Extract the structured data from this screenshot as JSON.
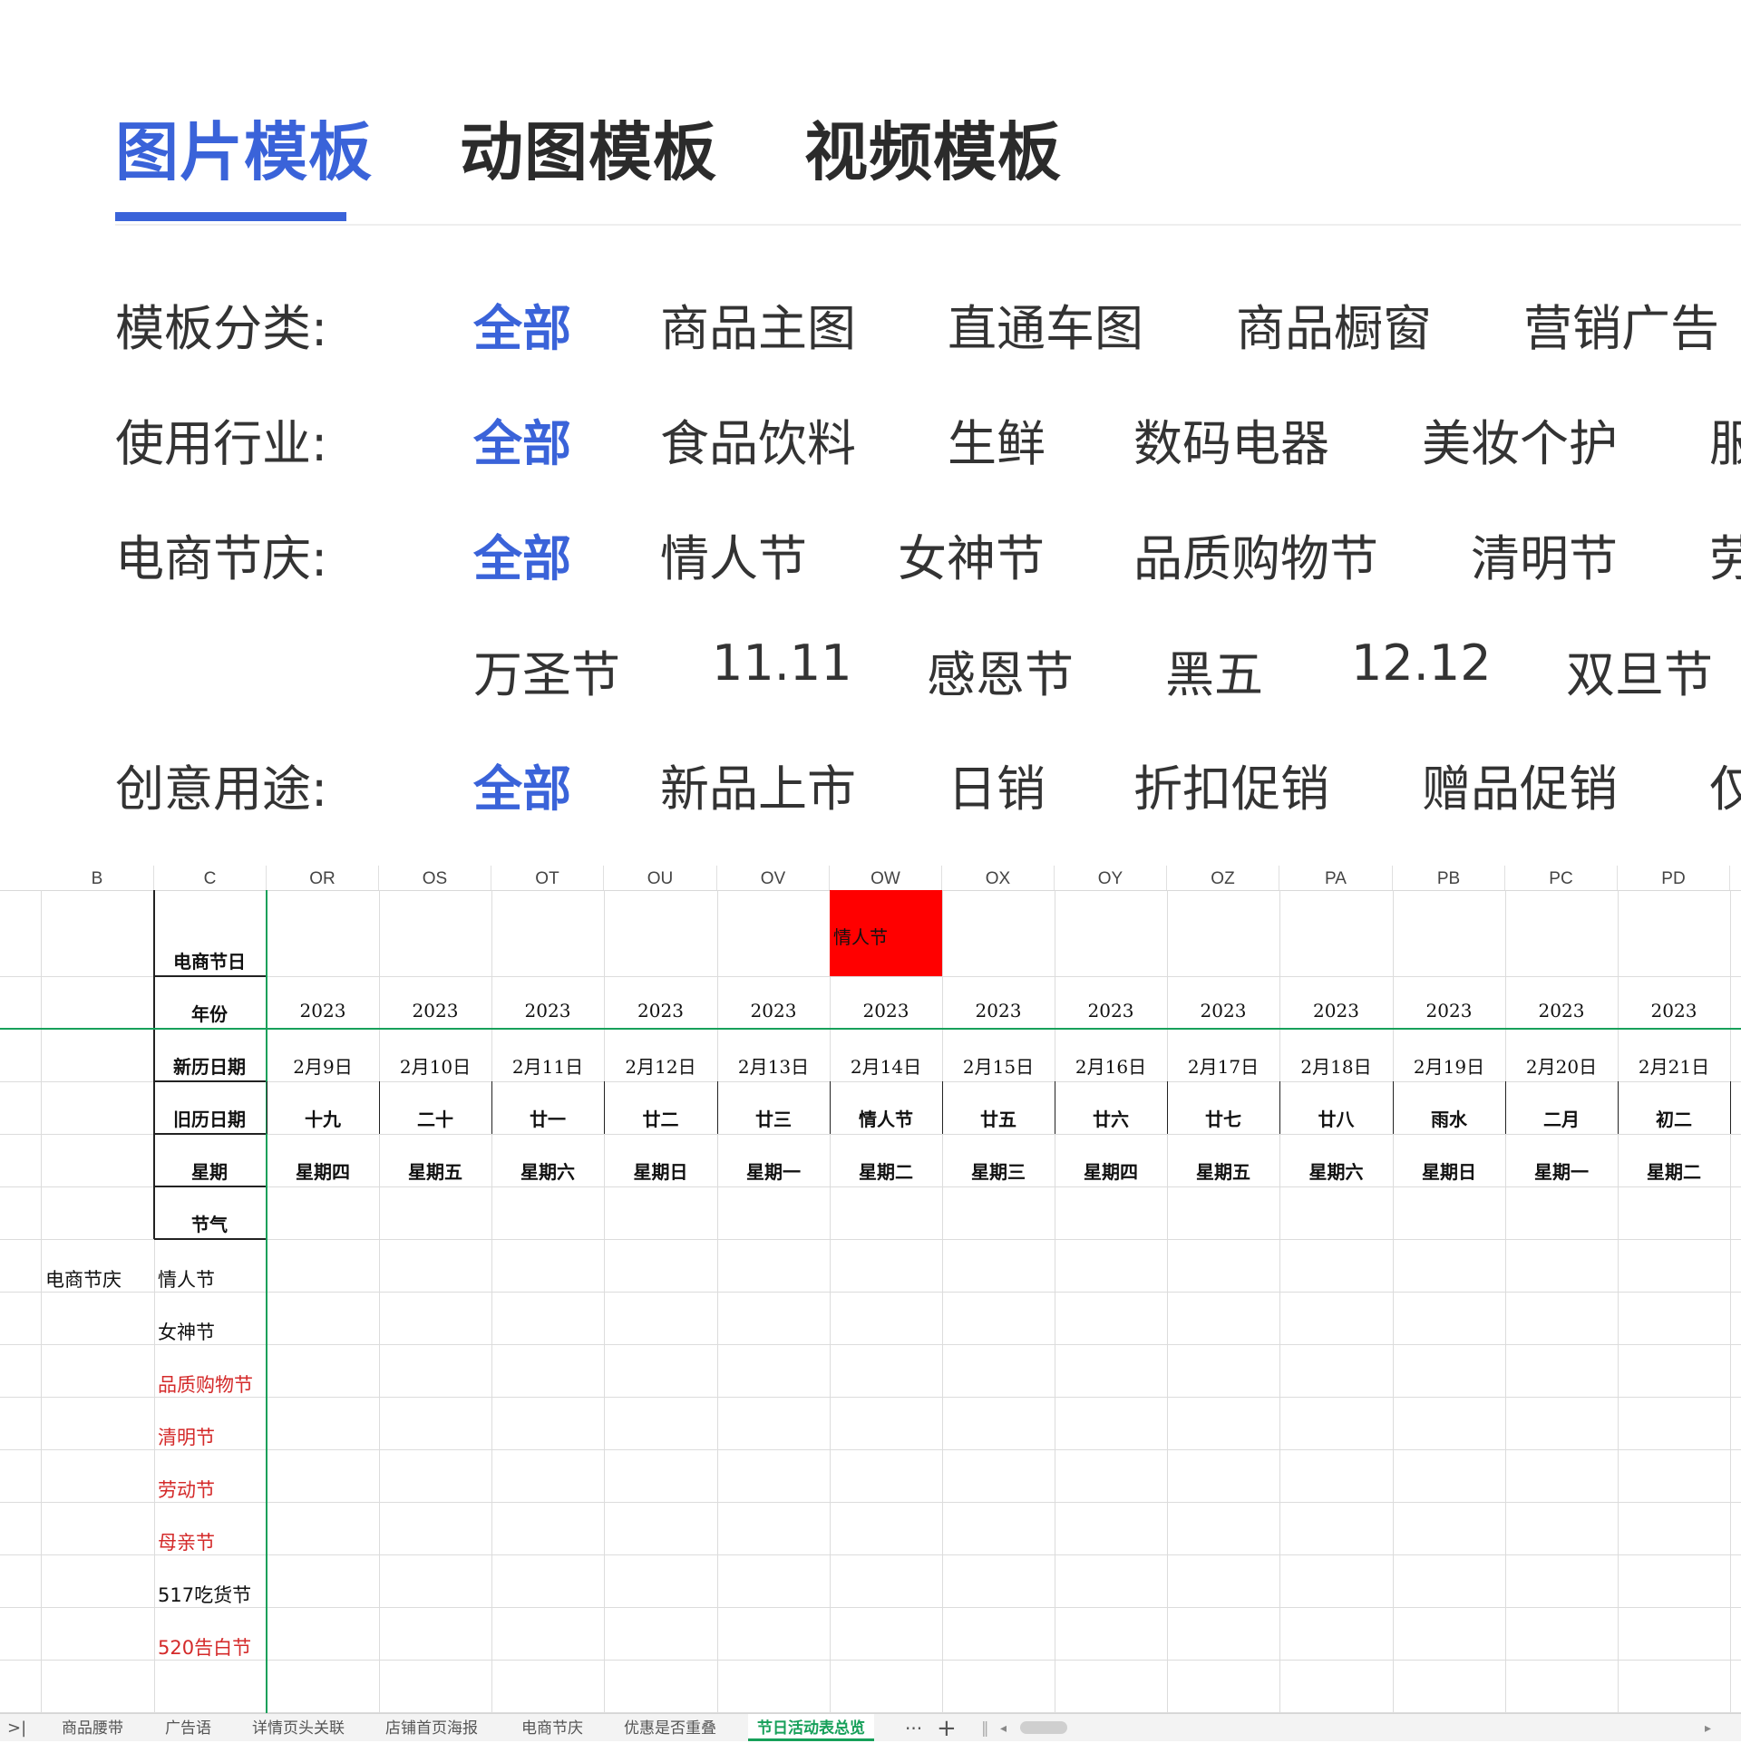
{
  "tabs": [
    "图片模板",
    "动图模板",
    "视频模板"
  ],
  "filters": {
    "category": {
      "label": "模板分类:",
      "options": [
        "全部",
        "商品主图",
        "直通车图",
        "商品橱窗",
        "营销广告"
      ]
    },
    "industry": {
      "label": "使用行业:",
      "options": [
        "全部",
        "食品饮料",
        "生鲜",
        "数码电器",
        "美妆个护",
        "服"
      ]
    },
    "festival": {
      "label": "电商节庆:",
      "options": [
        "全部",
        "情人节",
        "女神节",
        "品质购物节",
        "清明节",
        "劳"
      ]
    },
    "festival2": {
      "options": [
        "万圣节",
        "11.11",
        "感恩节",
        "黑五",
        "12.12",
        "双旦节"
      ]
    },
    "usage": {
      "label": "创意用途:",
      "options": [
        "全部",
        "新品上市",
        "日销",
        "折扣促销",
        "赠品促销",
        "仅"
      ]
    }
  },
  "colors": {
    "accent": "#3a63d9",
    "highlight": "#ff0000",
    "red_text": "#d42a2a",
    "sheet_green": "#17a05a"
  },
  "sheet": {
    "column_headers": [
      "B",
      "C",
      "OR",
      "OS",
      "OT",
      "OU",
      "OV",
      "OW",
      "OX",
      "OY",
      "OZ",
      "PA",
      "PB",
      "PC",
      "PD"
    ],
    "row_labels": {
      "festival_day": "电商节日",
      "year": "年份",
      "new_date": "新历日期",
      "old_date": "旧历日期",
      "weekday": "星期",
      "solar_term": "节气"
    },
    "highlight_cell": "情人节",
    "years": [
      "2023",
      "2023",
      "2023",
      "2023",
      "2023",
      "2023",
      "2023",
      "2023",
      "2023",
      "2023",
      "2023",
      "2023",
      "2023"
    ],
    "new_dates": [
      "2月9日",
      "2月10日",
      "2月11日",
      "2月12日",
      "2月13日",
      "2月14日",
      "2月15日",
      "2月16日",
      "2月17日",
      "2月18日",
      "2月19日",
      "2月20日",
      "2月21日"
    ],
    "old_dates": [
      "十九",
      "二十",
      "廿一",
      "廿二",
      "廿三",
      "情人节",
      "廿五",
      "廿六",
      "廿七",
      "廿八",
      "雨水",
      "二月",
      "初二"
    ],
    "weekdays": [
      "星期四",
      "星期五",
      "星期六",
      "星期日",
      "星期一",
      "星期二",
      "星期三",
      "星期四",
      "星期五",
      "星期六",
      "星期日",
      "星期一",
      "星期二"
    ],
    "group_label": "电商节庆",
    "festival_list": [
      {
        "name": "情人节",
        "red": false
      },
      {
        "name": "女神节",
        "red": false
      },
      {
        "name": "品质购物节",
        "red": true
      },
      {
        "name": "清明节",
        "red": true
      },
      {
        "name": "劳动节",
        "red": true
      },
      {
        "name": "母亲节",
        "red": true
      },
      {
        "name": "517吃货节",
        "red": false
      },
      {
        "name": "520告白节",
        "red": true
      }
    ],
    "sheet_tabs": [
      "商品腰带",
      "广告语",
      "详情页头关联",
      "店铺首页海报",
      "电商节庆",
      "优惠是否重叠",
      "节日活动表总览"
    ],
    "active_sheet_tab": "节日活动表总览",
    "more_label": "···",
    "add_label": "+"
  }
}
